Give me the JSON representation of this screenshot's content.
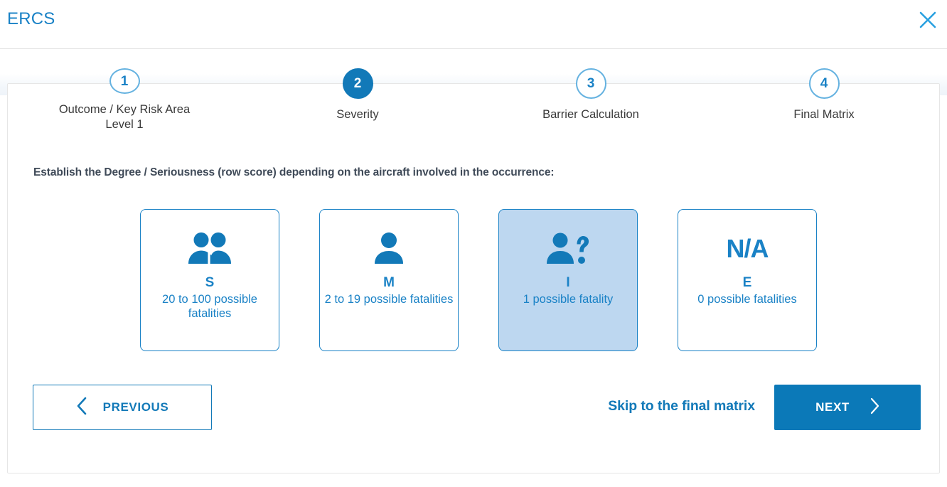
{
  "header": {
    "title": "ERCS",
    "close_icon": "close-icon"
  },
  "stepper": {
    "active_index": 1,
    "steps": [
      {
        "number": "1",
        "label": "Outcome / Key Risk Area Level 1"
      },
      {
        "number": "2",
        "label": "Severity"
      },
      {
        "number": "3",
        "label": "Barrier Calculation"
      },
      {
        "number": "4",
        "label": "Final Matrix"
      }
    ]
  },
  "main": {
    "instruction": "Establish the Degree / Seriousness (row score) depending on the aircraft involved in the occurrence:",
    "options": [
      {
        "icon": "two-people-icon",
        "code": "S",
        "description": "20 to 100 possible fatalities",
        "selected": false
      },
      {
        "icon": "person-icon",
        "code": "M",
        "description": "2 to 19 possible fatalities",
        "selected": false
      },
      {
        "icon": "person-question-icon",
        "code": "I",
        "description": "1 possible fatality",
        "selected": true
      },
      {
        "icon": "na-text-icon",
        "icon_text": "N/A",
        "code": "E",
        "description": "0 possible fatalities",
        "selected": false
      }
    ]
  },
  "footer": {
    "previous_label": "PREVIOUS",
    "skip_label": "Skip to the final matrix",
    "next_label": "NEXT"
  },
  "colors": {
    "accent_blue": "#1a82c6",
    "active_blue": "#1279b8",
    "next_button_blue": "#0b79b8",
    "selected_card_bg": "#bdd7f0",
    "instruction_text": "#3f4a58",
    "step_label_text": "#3a3a3a",
    "panel_border": "#e6e6e6"
  }
}
